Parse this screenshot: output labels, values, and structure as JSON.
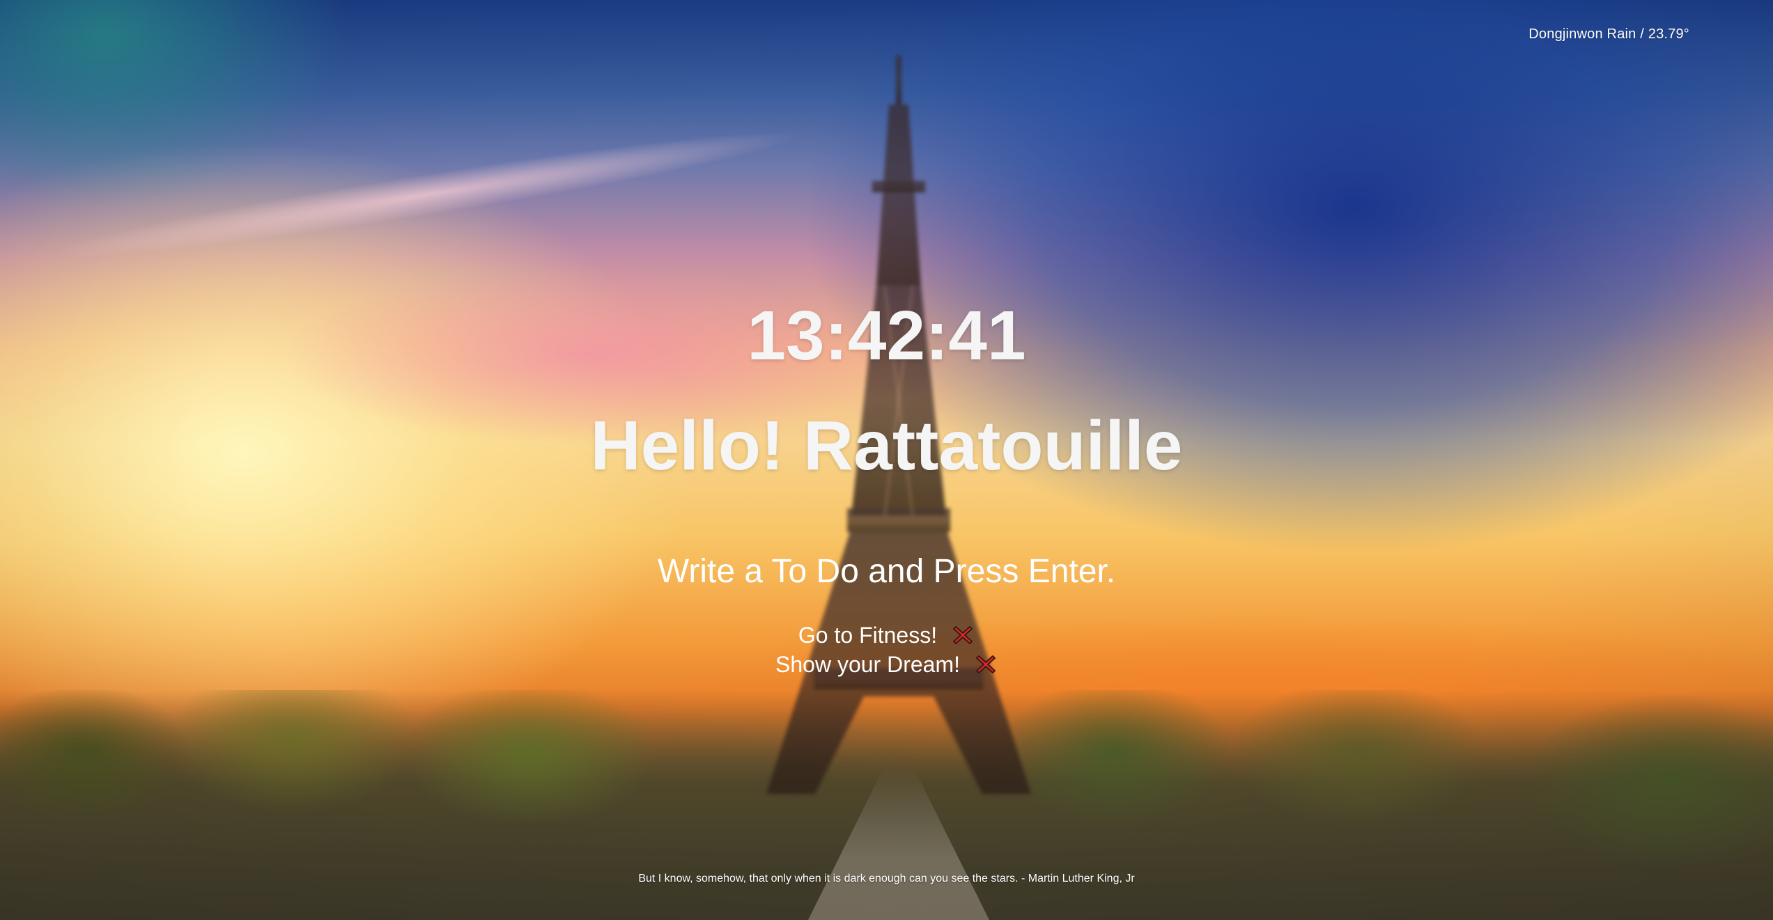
{
  "weather": {
    "text": "Dongjinwon Rain / 23.79°"
  },
  "clock": {
    "time": "13:42:41"
  },
  "greeting": {
    "text": "Hello! Rattatouille"
  },
  "todo": {
    "placeholder": "Write a To Do and Press Enter.",
    "items": [
      {
        "text": "Go to Fitness!",
        "delete_icon": "close-x-icon"
      },
      {
        "text": "Show your Dream!",
        "delete_icon": "close-x-icon"
      }
    ]
  },
  "quote": {
    "text": "But I know, somehow, that only when it is dark enough can you see the stars. - Martin Luther King, Jr"
  },
  "colors": {
    "text": "#ffffff",
    "delete_icon_fill": "#e0262b",
    "delete_icon_outline": "#3a1a12"
  }
}
